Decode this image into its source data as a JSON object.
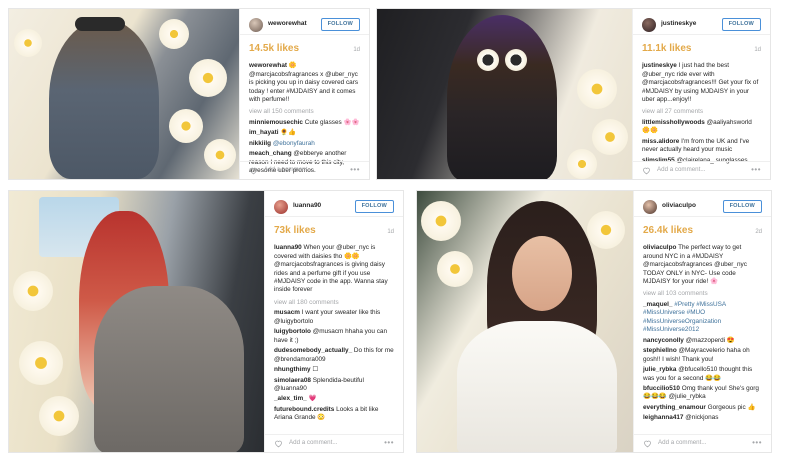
{
  "posts": [
    {
      "username": "weworewhat",
      "follow": "FOLLOW",
      "likes": "14.5k likes",
      "age": "1d",
      "caption_user": "weworewhat",
      "caption": "🌼 @marcjacobsfragrances x @uber_nyc is picking you up in daisy covered cars today ! enter #MJDAISY and it comes with perfume!!",
      "view_all": "view all 150 comments",
      "comments": [
        {
          "user": "minniemousechic",
          "text": "Cute glasses 🌸🌸"
        },
        {
          "user": "im_hayati",
          "text": "🌻👍"
        },
        {
          "user": "nikkiilg",
          "text": "@ebonyfaurah"
        },
        {
          "user": "meach_chang",
          "text": "@ebberye another reason I need to move to this city, awesome uber promos."
        }
      ],
      "add_comment": "Add a comment...",
      "more": "•••"
    },
    {
      "username": "justineskye",
      "follow": "FOLLOW",
      "likes": "11.1k likes",
      "age": "1d",
      "caption_user": "justineskye",
      "caption": "I just had the best @uber_nyc ride ever with @marcjacobsfragrances!!! Get your fix of #MJDAISY by using MJDAISY in your uber app...enjoy!!",
      "view_all": "view all 27 comments",
      "comments": [
        {
          "user": "littlemisshollywoods",
          "text": "@aaliyahsworld 🌼🌼"
        },
        {
          "user": "miss.alidore",
          "text": "I'm from the UK and I've never actually heard your music"
        },
        {
          "user": "slimslim55",
          "text": "@clairelana_ sunglasses"
        }
      ],
      "add_comment": "Add a comment...",
      "more": "•••"
    },
    {
      "username": "luanna90",
      "follow": "FOLLOW",
      "likes": "73k likes",
      "age": "1d",
      "caption_user": "luanna90",
      "caption": "When your @uber_nyc is covered with daisies tho 🌼🌼 @marcjacobsfragrances is giving daisy rides and a perfume gift if you use #MJDAISY code in the app. Wanna stay inside forever",
      "view_all": "view all 180 comments",
      "comments": [
        {
          "user": "musacm",
          "text": "I want your sweater like this @luigybortolo"
        },
        {
          "user": "luigybortolo",
          "text": "@musacm hhaha you can have it ;)"
        },
        {
          "user": "dudesomebody_actually_",
          "text": "Do this for me @brendamora009"
        },
        {
          "user": "nhungthimy",
          "text": "☐"
        },
        {
          "user": "simolaera08",
          "text": "Splendida-beutiful @luanna90"
        },
        {
          "user": "_alex_tim_",
          "text": "💗"
        },
        {
          "user": "futurebound.credits",
          "text": "Looks a bit like Ariana Grande 😳"
        }
      ],
      "add_comment": "Add a comment...",
      "more": "•••"
    },
    {
      "username": "oliviaculpo",
      "follow": "FOLLOW",
      "likes": "26.4k likes",
      "age": "2d",
      "caption_user": "oliviaculpo",
      "caption": "The perfect way to get around NYC in a #MJDAISY @marcjacobsfragrances @uber_nyc TODAY ONLY in NYC- Use code MJDAISY for your ride! 🌸",
      "view_all": "view all 103 comments",
      "comments": [
        {
          "user": "_maquel_",
          "text": "#Pretty #MissUSA #MissUniverse #MUO #MissUniverseOrganization #MissUniverse2012"
        },
        {
          "user": "nancyconolly",
          "text": "@mazzoperdi 😍"
        },
        {
          "user": "stephiellno",
          "text": "@Mayracvelerio haha oh gosh!! I wish! Thank you!"
        },
        {
          "user": "julie_rybka",
          "text": "@bfucello510 thought this was you for a second 😂😂"
        },
        {
          "user": "bfuccilio510",
          "text": "Omg thank you! She's gorg 😂😂😂 @julie_rybka"
        },
        {
          "user": "everything_enamour",
          "text": "Gorgeous pic 👍"
        },
        {
          "user": "leighanna417",
          "text": "@nickjonas"
        }
      ],
      "add_comment": "Add a comment...",
      "more": "•••"
    }
  ],
  "colors": {
    "likes": "#e3a949",
    "link": "#3f729b",
    "muted": "#a5a7aa"
  }
}
